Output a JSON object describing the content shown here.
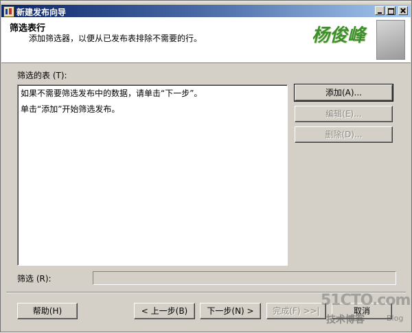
{
  "window": {
    "title": "新建发布向导",
    "controls": [
      "minimize-icon",
      "maximize-icon",
      "close-icon"
    ]
  },
  "header": {
    "title": "筛选表行",
    "subtitle": "添加筛选器，以便从已发布表排除不需要的行。",
    "logo_text": "杨俊峰"
  },
  "filtered_tables": {
    "label": "筛选的表 (T):",
    "lines": [
      "如果不需要筛选发布中的数据，请单击“下一步”。",
      "单击“添加”开始筛选发布。"
    ]
  },
  "side_buttons": {
    "add": "添加(A)...",
    "edit": "编辑(E)...",
    "delete": "删除(D)..."
  },
  "filter": {
    "label": "筛选 (R):",
    "value": ""
  },
  "footer": {
    "help": "帮助(H)",
    "back": "< 上一步(B)",
    "next": "下一步(N) >",
    "finish": "完成(F) >>|",
    "cancel": "取消"
  },
  "watermark": {
    "site": "51CTO.com",
    "tagline": "技术博客",
    "blog": "Blog"
  },
  "colors": {
    "titlebar_start": "#0a246a",
    "titlebar_end": "#a6caf0",
    "dialog_face": "#d4d0c8",
    "logo_green": "#3f8e2e"
  }
}
